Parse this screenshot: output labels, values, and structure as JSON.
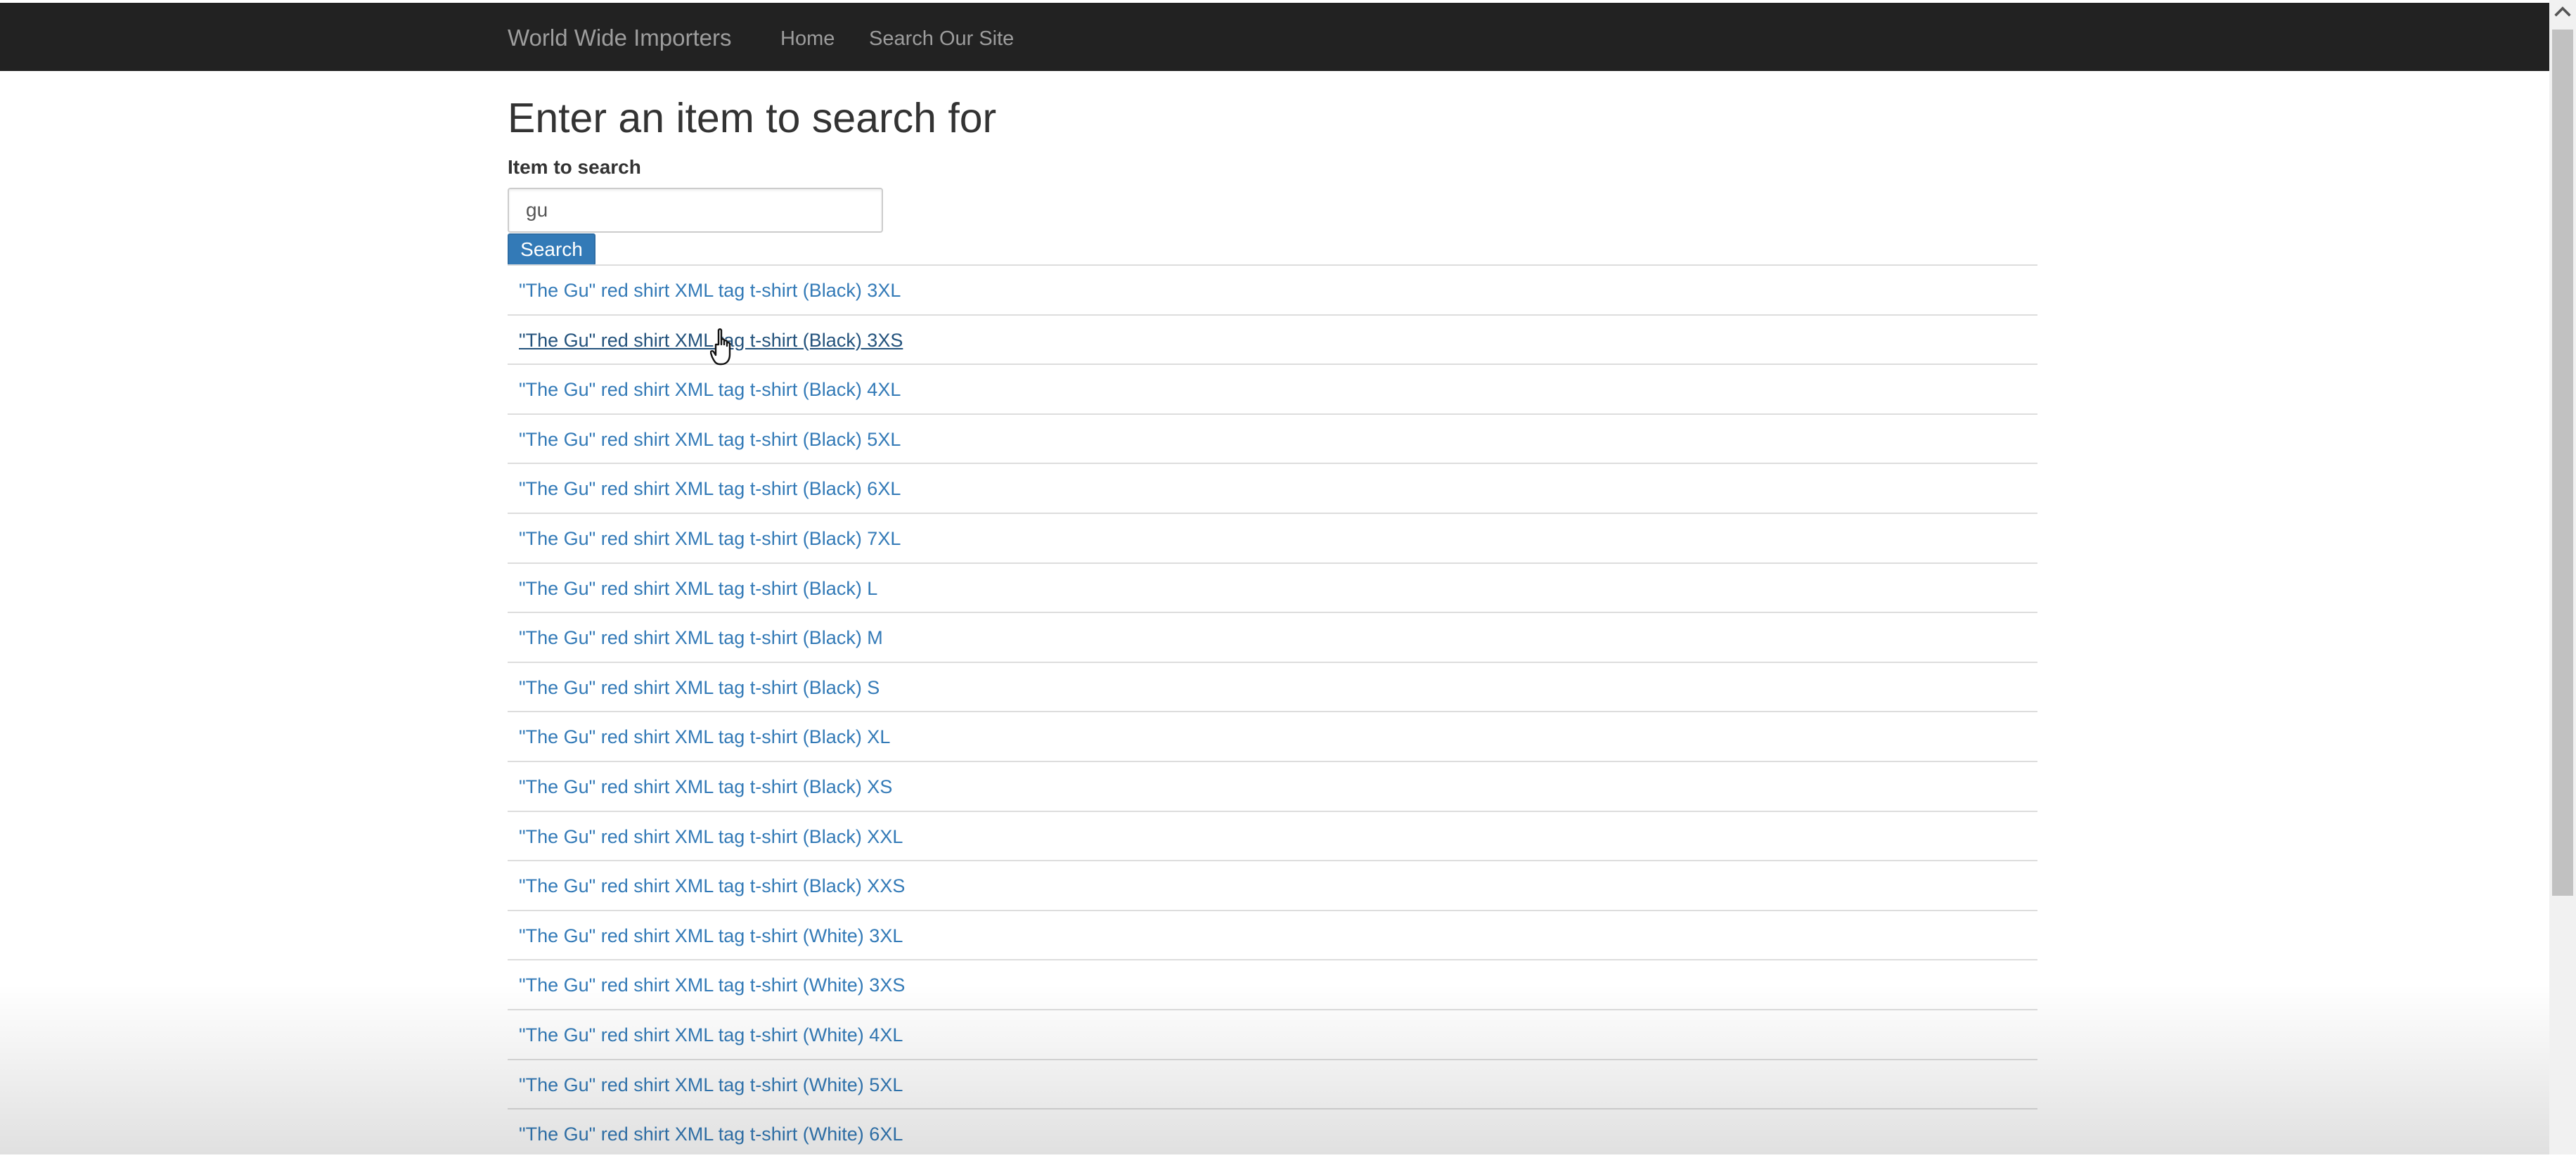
{
  "navbar": {
    "brand": "World Wide Importers",
    "links": [
      "Home",
      "Search Our Site"
    ]
  },
  "page": {
    "title": "Enter an item to search for"
  },
  "search": {
    "label": "Item to search",
    "value": "gu",
    "button_label": "Search"
  },
  "results": [
    "\"The Gu\" red shirt XML tag t-shirt (Black) 3XL",
    "\"The Gu\" red shirt XML tag t-shirt (Black) 3XS",
    "\"The Gu\" red shirt XML tag t-shirt (Black) 4XL",
    "\"The Gu\" red shirt XML tag t-shirt (Black) 5XL",
    "\"The Gu\" red shirt XML tag t-shirt (Black) 6XL",
    "\"The Gu\" red shirt XML tag t-shirt (Black) 7XL",
    "\"The Gu\" red shirt XML tag t-shirt (Black) L",
    "\"The Gu\" red shirt XML tag t-shirt (Black) M",
    "\"The Gu\" red shirt XML tag t-shirt (Black) S",
    "\"The Gu\" red shirt XML tag t-shirt (Black) XL",
    "\"The Gu\" red shirt XML tag t-shirt (Black) XS",
    "\"The Gu\" red shirt XML tag t-shirt (Black) XXL",
    "\"The Gu\" red shirt XML tag t-shirt (Black) XXS",
    "\"The Gu\" red shirt XML tag t-shirt (White) 3XL",
    "\"The Gu\" red shirt XML tag t-shirt (White) 3XS",
    "\"The Gu\" red shirt XML tag t-shirt (White) 4XL",
    "\"The Gu\" red shirt XML tag t-shirt (White) 5XL",
    "\"The Gu\" red shirt XML tag t-shirt (White) 6XL"
  ],
  "hovered_result_index": 1,
  "icons": {
    "cursor": "hand-pointer-icon",
    "scroll_up": "chevron-up-icon"
  },
  "colors": {
    "navbar_bg": "#222222",
    "nav_text": "#9d9d9d",
    "link": "#337ab7",
    "button": "#337ab7"
  }
}
